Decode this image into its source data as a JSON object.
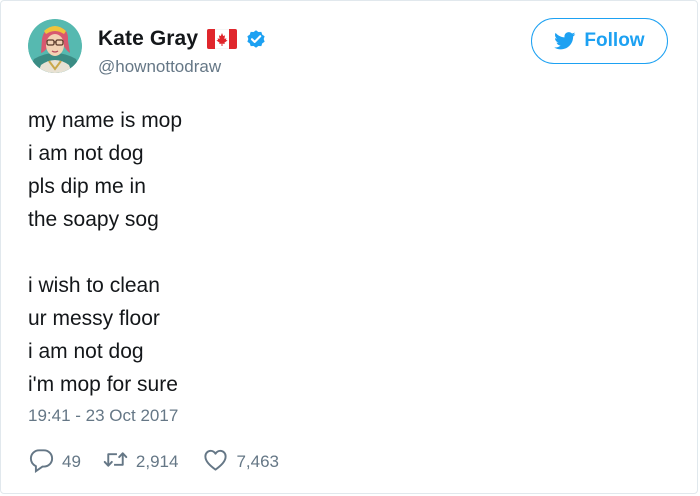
{
  "author": {
    "display_name": "Kate Gray",
    "handle": "@hownottodraw",
    "flag_icon": "canada-flag-icon",
    "verified_icon": "verified-badge-icon"
  },
  "follow_button": {
    "label": "Follow",
    "icon": "twitter-bird-icon"
  },
  "tweet": {
    "lines": [
      "my name is mop",
      "i am not dog",
      "pls dip me in",
      "the soapy sog",
      "",
      "i wish to clean",
      "ur messy floor",
      "i am not dog",
      "i'm mop for sure"
    ],
    "timestamp": "19:41 - 23 Oct 2017"
  },
  "actions": {
    "replies": "49",
    "retweets": "2,914",
    "likes": "7,463"
  },
  "colors": {
    "accent": "#1da1f2",
    "text": "#14171a",
    "muted": "#657786",
    "flag_red": "#e0262c",
    "border": "#e1e8ed"
  }
}
